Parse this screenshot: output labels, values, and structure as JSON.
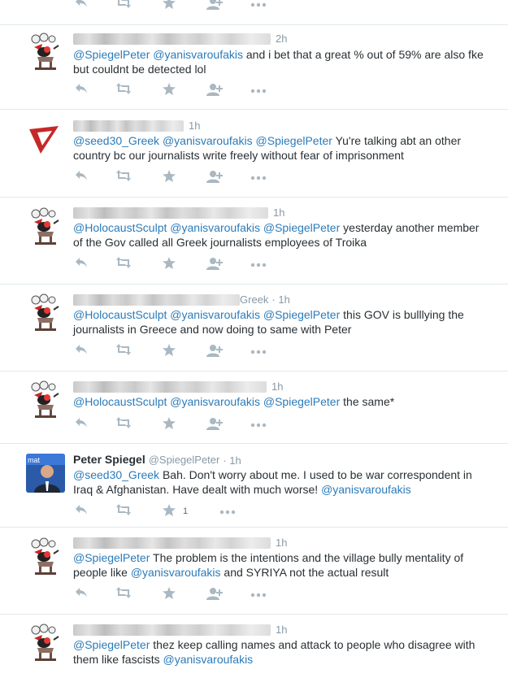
{
  "colors": {
    "link": "#2b7bb9",
    "text": "#292f33",
    "meta": "#8899a6",
    "action": "#aab8c2",
    "divider": "#e1e8ed"
  },
  "icons": {
    "reply": "reply-icon",
    "retweet": "retweet-icon",
    "favorite": "star-icon",
    "follow": "follow-icon",
    "more": "more-icon"
  },
  "tweets": [
    {
      "avatar": "cartoon-avatar",
      "time": "2h",
      "mentions": [
        "@SpiegelPeter",
        "@yanisvaroufakis"
      ],
      "text": "and i bet that a great % out of 59% are also fke but couldnt be detected lol"
    },
    {
      "avatar": "red-logo-avatar",
      "time": "1h",
      "mentions": [
        "@seed30_Greek",
        "@yanisvaroufakis",
        "@SpiegelPeter"
      ],
      "text": "Yu're talking abt an other country bc our journalists write freely without fear of imprisonment"
    },
    {
      "avatar": "cartoon-avatar",
      "time": "1h",
      "mentions": [
        "@HolocaustSculpt",
        "@yanisvaroufakis",
        "@SpiegelPeter"
      ],
      "text": "yesterday another member of the Gov called all Greek journalists employees of Troika"
    },
    {
      "avatar": "cartoon-avatar",
      "name_fragment": "Greek",
      "time": "1h",
      "mentions": [
        "@HolocaustSculpt",
        "@yanisvaroufakis",
        "@SpiegelPeter"
      ],
      "text": "this GOV is bulllying the journalists in Greece and now doing to same with Peter"
    },
    {
      "avatar": "cartoon-avatar",
      "time": "1h",
      "mentions": [
        "@HolocaustSculpt",
        "@yanisvaroufakis",
        "@SpiegelPeter"
      ],
      "text": "the same*"
    },
    {
      "avatar": "photo-avatar",
      "fullname": "Peter Spiegel",
      "handle": "@SpiegelPeter",
      "time": "1h",
      "mentions": [
        "@seed30_Greek"
      ],
      "text": "Bah. Don't worry about me. I used to be war correspondent in Iraq & Afghanistan. Have dealt with much worse!",
      "trailing_mention": "@yanisvaroufakis",
      "favorite_count": "1"
    },
    {
      "avatar": "cartoon-avatar",
      "time": "1h",
      "mentions": [
        "@SpiegelPeter"
      ],
      "text": "The problem is the intentions and the village bully mentality of people like",
      "trailing_mention": "@yanisvaroufakis",
      "text_after": "and SYRIYA not the actual result"
    },
    {
      "avatar": "cartoon-avatar",
      "time": "1h",
      "mentions": [
        "@SpiegelPeter"
      ],
      "text": "thez keep calling names and attack to people who disagree with them like fascists",
      "trailing_mention": "@yanisvaroufakis"
    }
  ]
}
